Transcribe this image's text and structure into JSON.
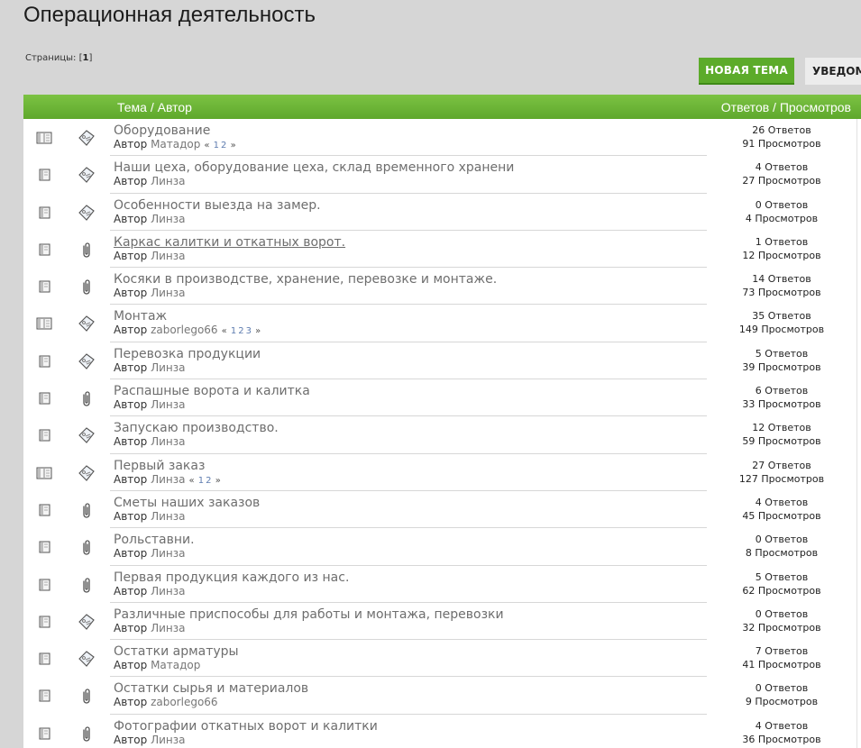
{
  "page": {
    "title": "Операционная деятельность",
    "pages_label": "Страницы:",
    "pages_current": "1",
    "new_topic_label": "НОВАЯ ТЕМА",
    "notify_label": "УВЕДОМЛ"
  },
  "table": {
    "header_topic": "Тема / Автор",
    "header_stats": "Ответов / Просмотров",
    "author_prefix": "Автор",
    "rows": [
      {
        "title": "Оборудование",
        "author": "Матадор",
        "status_icon": "hot-topic-icon",
        "type_icon": "sticky-tag-icon",
        "pages": [
          "1",
          "2"
        ],
        "replies": "26 Ответов",
        "views": "91 Просмотров"
      },
      {
        "title": "Наши цеха, оборудование цеха, склад временного хранени",
        "author": "Линза",
        "status_icon": "topic-icon",
        "type_icon": "sticky-tag-icon",
        "pages": [],
        "replies": "4 Ответов",
        "views": "27 Просмотров"
      },
      {
        "title": "Особенности выезда на замер.",
        "author": "Линза",
        "status_icon": "topic-icon",
        "type_icon": "sticky-tag-icon",
        "pages": [],
        "replies": "0 Ответов",
        "views": "4 Просмотров"
      },
      {
        "title": "Каркас калитки и откатных ворот.",
        "author": "Линза",
        "status_icon": "topic-icon",
        "type_icon": "paperclip-icon",
        "pages": [],
        "replies": "1 Ответов",
        "views": "12 Просмотров",
        "underline": true
      },
      {
        "title": "Косяки в производстве, хранение, перевозке и монтаже.",
        "author": "Линза",
        "status_icon": "topic-icon",
        "type_icon": "paperclip-icon",
        "pages": [],
        "replies": "14 Ответов",
        "views": "73 Просмотров"
      },
      {
        "title": "Монтаж",
        "author": "zaborlego66",
        "status_icon": "hot-topic-icon",
        "type_icon": "sticky-tag-icon",
        "pages": [
          "1",
          "2",
          "3"
        ],
        "replies": "35 Ответов",
        "views": "149 Просмотров"
      },
      {
        "title": "Перевозка продукции",
        "author": "Линза",
        "status_icon": "topic-icon",
        "type_icon": "sticky-tag-icon",
        "pages": [],
        "replies": "5 Ответов",
        "views": "39 Просмотров"
      },
      {
        "title": "Распашные ворота и калитка",
        "author": "Линза",
        "status_icon": "topic-icon",
        "type_icon": "paperclip-icon",
        "pages": [],
        "replies": "6 Ответов",
        "views": "33 Просмотров"
      },
      {
        "title": "Запускаю производство.",
        "author": "Линза",
        "status_icon": "topic-icon",
        "type_icon": "sticky-tag-icon",
        "pages": [],
        "replies": "12 Ответов",
        "views": "59 Просмотров"
      },
      {
        "title": "Первый заказ",
        "author": "Линза",
        "status_icon": "hot-topic-icon",
        "type_icon": "sticky-tag-icon",
        "pages": [
          "1",
          "2"
        ],
        "replies": "27 Ответов",
        "views": "127 Просмотров"
      },
      {
        "title": "Сметы наших заказов",
        "author": "Линза",
        "status_icon": "topic-icon",
        "type_icon": "paperclip-icon",
        "pages": [],
        "replies": "4 Ответов",
        "views": "45 Просмотров"
      },
      {
        "title": "Рольставни.",
        "author": "Линза",
        "status_icon": "topic-icon",
        "type_icon": "paperclip-icon",
        "pages": [],
        "replies": "0 Ответов",
        "views": "8 Просмотров"
      },
      {
        "title": "Первая продукция каждого из нас.",
        "author": "Линза",
        "status_icon": "topic-icon",
        "type_icon": "paperclip-icon",
        "pages": [],
        "replies": "5 Ответов",
        "views": "62 Просмотров"
      },
      {
        "title": "Различные приспособы для работы и монтажа, перевозки",
        "author": "Линза",
        "status_icon": "topic-icon",
        "type_icon": "sticky-tag-icon",
        "pages": [],
        "replies": "0 Ответов",
        "views": "32 Просмотров"
      },
      {
        "title": "Остатки арматуры",
        "author": "Матадор",
        "status_icon": "topic-icon",
        "type_icon": "sticky-tag-icon",
        "pages": [],
        "replies": "7 Ответов",
        "views": "41 Просмотров"
      },
      {
        "title": "Остатки сырья и материалов",
        "author": "zaborlego66",
        "status_icon": "topic-icon",
        "type_icon": "paperclip-icon",
        "pages": [],
        "replies": "0 Ответов",
        "views": "9 Просмотров"
      },
      {
        "title": "Фотографии откатных ворот и калитки",
        "author": "Линза",
        "status_icon": "topic-icon",
        "type_icon": "paperclip-icon",
        "pages": [],
        "replies": "4 Ответов",
        "views": "36 Просмотров"
      }
    ]
  }
}
